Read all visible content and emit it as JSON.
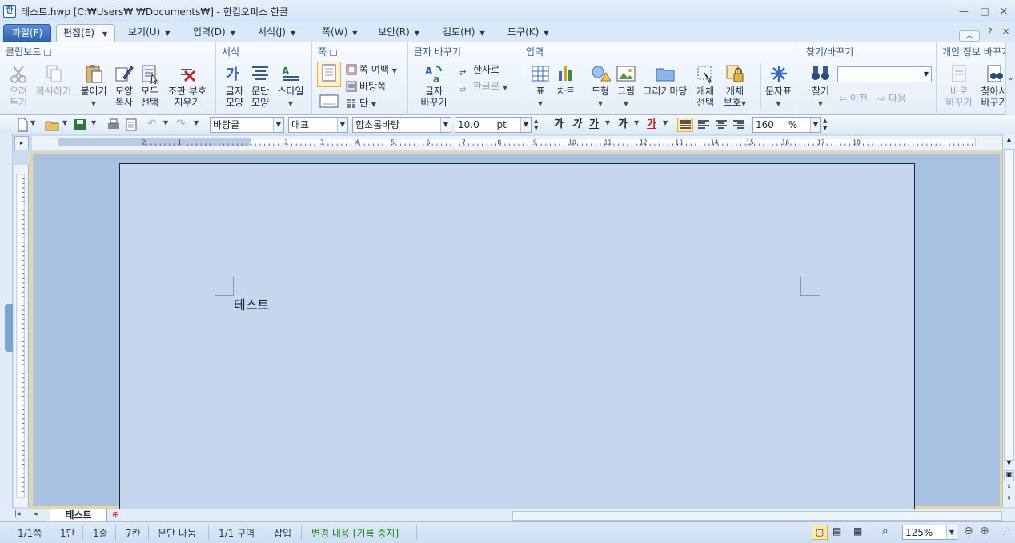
{
  "window": {
    "title": "테스트.hwp [C:₩Users₩            ₩Documents₩] - 한컴오피스 한글",
    "app_icon": "hwp-app-icon",
    "min_label": "—",
    "max_label": "□",
    "close_label": "✕"
  },
  "menu": {
    "file": "파일(F)",
    "edit": "편집(E)",
    "view": "보기(U)",
    "input": "입력(D)",
    "format": "서식(J)",
    "page": "쪽(W)",
    "security": "보안(R)",
    "review": "검토(H)",
    "tools": "도구(K)",
    "help": "?"
  },
  "ribbon": {
    "clipboard": {
      "title": "클립보드",
      "cut": "오려\n두기",
      "copy": "복사하기",
      "paste": "붙이기",
      "copy_format": "모양\n복사",
      "select_all": "모두\n선택",
      "delete_markers": "조판 부호\n지우기"
    },
    "format": {
      "title": "서식",
      "char_shape": "글자\n모양",
      "para_shape": "문단\n모양",
      "style": "스타일"
    },
    "page": {
      "title": "쪽",
      "page_margin": "쪽 여백",
      "master_page": "바탕쪽",
      "columns": "단"
    },
    "char_replace": {
      "title": "글자 바꾸기",
      "char_change": "글자\n바꾸기",
      "to_hanja": "한자로",
      "to_hangul": "한글로"
    },
    "insert": {
      "title": "입력",
      "table": "표",
      "chart": "차트",
      "shape": "도형",
      "picture": "그림",
      "drawing_art": "그리기마당",
      "object_select": "개체\n선택",
      "object_protect": "개체\n보호",
      "char_map": "문자표"
    },
    "find": {
      "title": "찾기/바꾸기",
      "find": "찾기",
      "prev": "이전",
      "next": "다음"
    },
    "privacy": {
      "title": "개인 정보 바꾸기",
      "replace_now": "바로\n바꾸기",
      "find_replace": "찾아서\n바꾸기"
    }
  },
  "toolbar": {
    "style_name": "바탕글",
    "lang": "대표",
    "font_name": "함초롬바탕",
    "font_size": "10.0",
    "font_unit": "pt",
    "bold": "가",
    "italic": "가",
    "underline": "가",
    "outline": "가",
    "color": "가",
    "line_spacing": "160",
    "line_unit": "%"
  },
  "document": {
    "text": "테스트",
    "tab_name": "테스트"
  },
  "status": {
    "page": "1/1쪽",
    "column": "1단",
    "line": "1줄",
    "col": "7칸",
    "para_break": "문단 나눔",
    "section": "1/1 구역",
    "insert_mode": "삽입",
    "track_changes": "변경 내용 [기록 중지]",
    "zoom": "125%"
  },
  "colors": {
    "accent": "#2e65b0",
    "track_changes": "#1a8a1a",
    "red_text": "#d01818"
  }
}
